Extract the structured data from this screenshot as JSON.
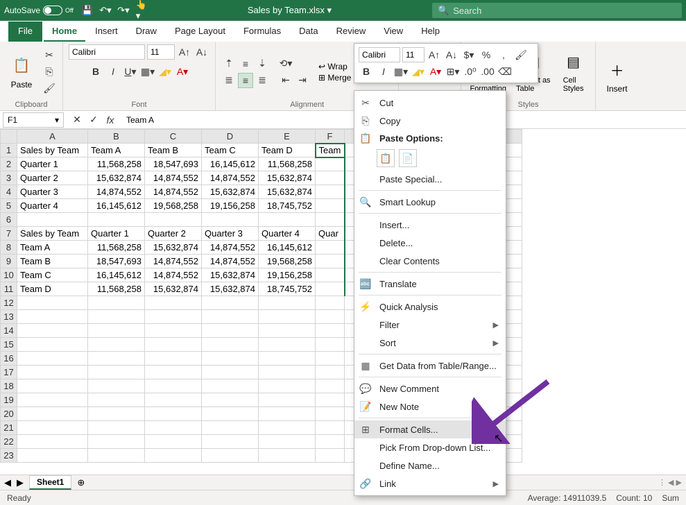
{
  "titlebar": {
    "autosave": "AutoSave",
    "autosave_state": "Off",
    "filename": "Sales by Team.xlsx ▾",
    "search_placeholder": "Search"
  },
  "tabs": {
    "file": "File",
    "home": "Home",
    "insert": "Insert",
    "draw": "Draw",
    "page_layout": "Page Layout",
    "formulas": "Formulas",
    "data": "Data",
    "review": "Review",
    "view": "View",
    "help": "Help"
  },
  "ribbon": {
    "clipboard": {
      "label": "Clipboard",
      "paste": "Paste"
    },
    "font": {
      "label": "Font",
      "name": "Calibri",
      "size": "11"
    },
    "alignment": {
      "label": "Alignment",
      "wrap": "Wrap",
      "merge": "Merge & Center"
    },
    "number": {
      "label": "Num..."
    },
    "styles": {
      "label": "Styles",
      "cond": "onditional\nFormatting",
      "table": "Format as\nTable",
      "cell": "Cell\nStyles"
    },
    "cells": {
      "insert": "Insert"
    }
  },
  "formula_bar": {
    "name_box": "F1",
    "value": "Team A"
  },
  "columns": [
    "A",
    "B",
    "C",
    "D",
    "E",
    "F",
    "I",
    "J",
    "K",
    "L"
  ],
  "grid": {
    "r1": [
      "Sales by Team",
      "Team A",
      "Team B",
      "Team C",
      "Team D",
      "Team"
    ],
    "r2": [
      "Quarter 1",
      "11,568,258",
      "18,547,693",
      "16,145,612",
      "11,568,258",
      ""
    ],
    "r3": [
      "Quarter 2",
      "15,632,874",
      "14,874,552",
      "14,874,552",
      "15,632,874",
      ""
    ],
    "r4": [
      "Quarter 3",
      "14,874,552",
      "14,874,552",
      "15,632,874",
      "15,632,874",
      ""
    ],
    "r5": [
      "Quarter 4",
      "16,145,612",
      "19,568,258",
      "19,156,258",
      "18,745,752",
      ""
    ],
    "r7": [
      "Sales by Team",
      "Quarter 1",
      "Quarter 2",
      "Quarter 3",
      "Quarter 4",
      "Quar"
    ],
    "r8": [
      "Team A",
      "11,568,258",
      "15,632,874",
      "14,874,552",
      "16,145,612",
      ""
    ],
    "r9": [
      "Team B",
      "18,547,693",
      "14,874,552",
      "14,874,552",
      "19,568,258",
      ""
    ],
    "r10": [
      "Team C",
      "16,145,612",
      "14,874,552",
      "15,632,874",
      "19,156,258",
      ""
    ],
    "r11": [
      "Team D",
      "11,568,258",
      "15,632,874",
      "15,632,874",
      "18,745,752",
      ""
    ]
  },
  "sheet_tab": "Sheet1",
  "status": {
    "ready": "Ready",
    "avg": "Average: 14911039.5",
    "count": "Count: 10",
    "sum": "Sum"
  },
  "mini": {
    "font": "Calibri",
    "size": "11"
  },
  "ctx": {
    "cut": "Cut",
    "copy": "Copy",
    "paste_options": "Paste Options:",
    "paste_special": "Paste Special...",
    "smart_lookup": "Smart Lookup",
    "insert": "Insert...",
    "delete": "Delete...",
    "clear": "Clear Contents",
    "translate": "Translate",
    "quick": "Quick Analysis",
    "filter": "Filter",
    "sort": "Sort",
    "getdata": "Get Data from Table/Range...",
    "newcomment": "New Comment",
    "newnote": "New Note",
    "format_cells": "Format Cells...",
    "pick": "Pick From Drop-down List...",
    "define": "Define Name...",
    "link": "Link"
  }
}
